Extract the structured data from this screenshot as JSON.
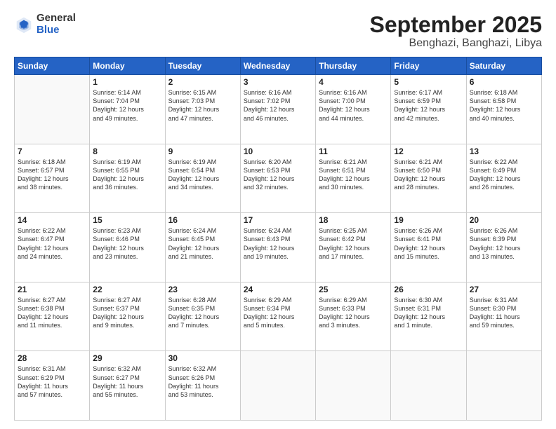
{
  "logo": {
    "general": "General",
    "blue": "Blue"
  },
  "title": {
    "month": "September 2025",
    "location": "Benghazi, Banghazi, Libya"
  },
  "weekdays": [
    "Sunday",
    "Monday",
    "Tuesday",
    "Wednesday",
    "Thursday",
    "Friday",
    "Saturday"
  ],
  "weeks": [
    [
      {
        "day": "",
        "info": ""
      },
      {
        "day": "1",
        "info": "Sunrise: 6:14 AM\nSunset: 7:04 PM\nDaylight: 12 hours\nand 49 minutes."
      },
      {
        "day": "2",
        "info": "Sunrise: 6:15 AM\nSunset: 7:03 PM\nDaylight: 12 hours\nand 47 minutes."
      },
      {
        "day": "3",
        "info": "Sunrise: 6:16 AM\nSunset: 7:02 PM\nDaylight: 12 hours\nand 46 minutes."
      },
      {
        "day": "4",
        "info": "Sunrise: 6:16 AM\nSunset: 7:00 PM\nDaylight: 12 hours\nand 44 minutes."
      },
      {
        "day": "5",
        "info": "Sunrise: 6:17 AM\nSunset: 6:59 PM\nDaylight: 12 hours\nand 42 minutes."
      },
      {
        "day": "6",
        "info": "Sunrise: 6:18 AM\nSunset: 6:58 PM\nDaylight: 12 hours\nand 40 minutes."
      }
    ],
    [
      {
        "day": "7",
        "info": "Sunrise: 6:18 AM\nSunset: 6:57 PM\nDaylight: 12 hours\nand 38 minutes."
      },
      {
        "day": "8",
        "info": "Sunrise: 6:19 AM\nSunset: 6:55 PM\nDaylight: 12 hours\nand 36 minutes."
      },
      {
        "day": "9",
        "info": "Sunrise: 6:19 AM\nSunset: 6:54 PM\nDaylight: 12 hours\nand 34 minutes."
      },
      {
        "day": "10",
        "info": "Sunrise: 6:20 AM\nSunset: 6:53 PM\nDaylight: 12 hours\nand 32 minutes."
      },
      {
        "day": "11",
        "info": "Sunrise: 6:21 AM\nSunset: 6:51 PM\nDaylight: 12 hours\nand 30 minutes."
      },
      {
        "day": "12",
        "info": "Sunrise: 6:21 AM\nSunset: 6:50 PM\nDaylight: 12 hours\nand 28 minutes."
      },
      {
        "day": "13",
        "info": "Sunrise: 6:22 AM\nSunset: 6:49 PM\nDaylight: 12 hours\nand 26 minutes."
      }
    ],
    [
      {
        "day": "14",
        "info": "Sunrise: 6:22 AM\nSunset: 6:47 PM\nDaylight: 12 hours\nand 24 minutes."
      },
      {
        "day": "15",
        "info": "Sunrise: 6:23 AM\nSunset: 6:46 PM\nDaylight: 12 hours\nand 23 minutes."
      },
      {
        "day": "16",
        "info": "Sunrise: 6:24 AM\nSunset: 6:45 PM\nDaylight: 12 hours\nand 21 minutes."
      },
      {
        "day": "17",
        "info": "Sunrise: 6:24 AM\nSunset: 6:43 PM\nDaylight: 12 hours\nand 19 minutes."
      },
      {
        "day": "18",
        "info": "Sunrise: 6:25 AM\nSunset: 6:42 PM\nDaylight: 12 hours\nand 17 minutes."
      },
      {
        "day": "19",
        "info": "Sunrise: 6:26 AM\nSunset: 6:41 PM\nDaylight: 12 hours\nand 15 minutes."
      },
      {
        "day": "20",
        "info": "Sunrise: 6:26 AM\nSunset: 6:39 PM\nDaylight: 12 hours\nand 13 minutes."
      }
    ],
    [
      {
        "day": "21",
        "info": "Sunrise: 6:27 AM\nSunset: 6:38 PM\nDaylight: 12 hours\nand 11 minutes."
      },
      {
        "day": "22",
        "info": "Sunrise: 6:27 AM\nSunset: 6:37 PM\nDaylight: 12 hours\nand 9 minutes."
      },
      {
        "day": "23",
        "info": "Sunrise: 6:28 AM\nSunset: 6:35 PM\nDaylight: 12 hours\nand 7 minutes."
      },
      {
        "day": "24",
        "info": "Sunrise: 6:29 AM\nSunset: 6:34 PM\nDaylight: 12 hours\nand 5 minutes."
      },
      {
        "day": "25",
        "info": "Sunrise: 6:29 AM\nSunset: 6:33 PM\nDaylight: 12 hours\nand 3 minutes."
      },
      {
        "day": "26",
        "info": "Sunrise: 6:30 AM\nSunset: 6:31 PM\nDaylight: 12 hours\nand 1 minute."
      },
      {
        "day": "27",
        "info": "Sunrise: 6:31 AM\nSunset: 6:30 PM\nDaylight: 11 hours\nand 59 minutes."
      }
    ],
    [
      {
        "day": "28",
        "info": "Sunrise: 6:31 AM\nSunset: 6:29 PM\nDaylight: 11 hours\nand 57 minutes."
      },
      {
        "day": "29",
        "info": "Sunrise: 6:32 AM\nSunset: 6:27 PM\nDaylight: 11 hours\nand 55 minutes."
      },
      {
        "day": "30",
        "info": "Sunrise: 6:32 AM\nSunset: 6:26 PM\nDaylight: 11 hours\nand 53 minutes."
      },
      {
        "day": "",
        "info": ""
      },
      {
        "day": "",
        "info": ""
      },
      {
        "day": "",
        "info": ""
      },
      {
        "day": "",
        "info": ""
      }
    ]
  ]
}
